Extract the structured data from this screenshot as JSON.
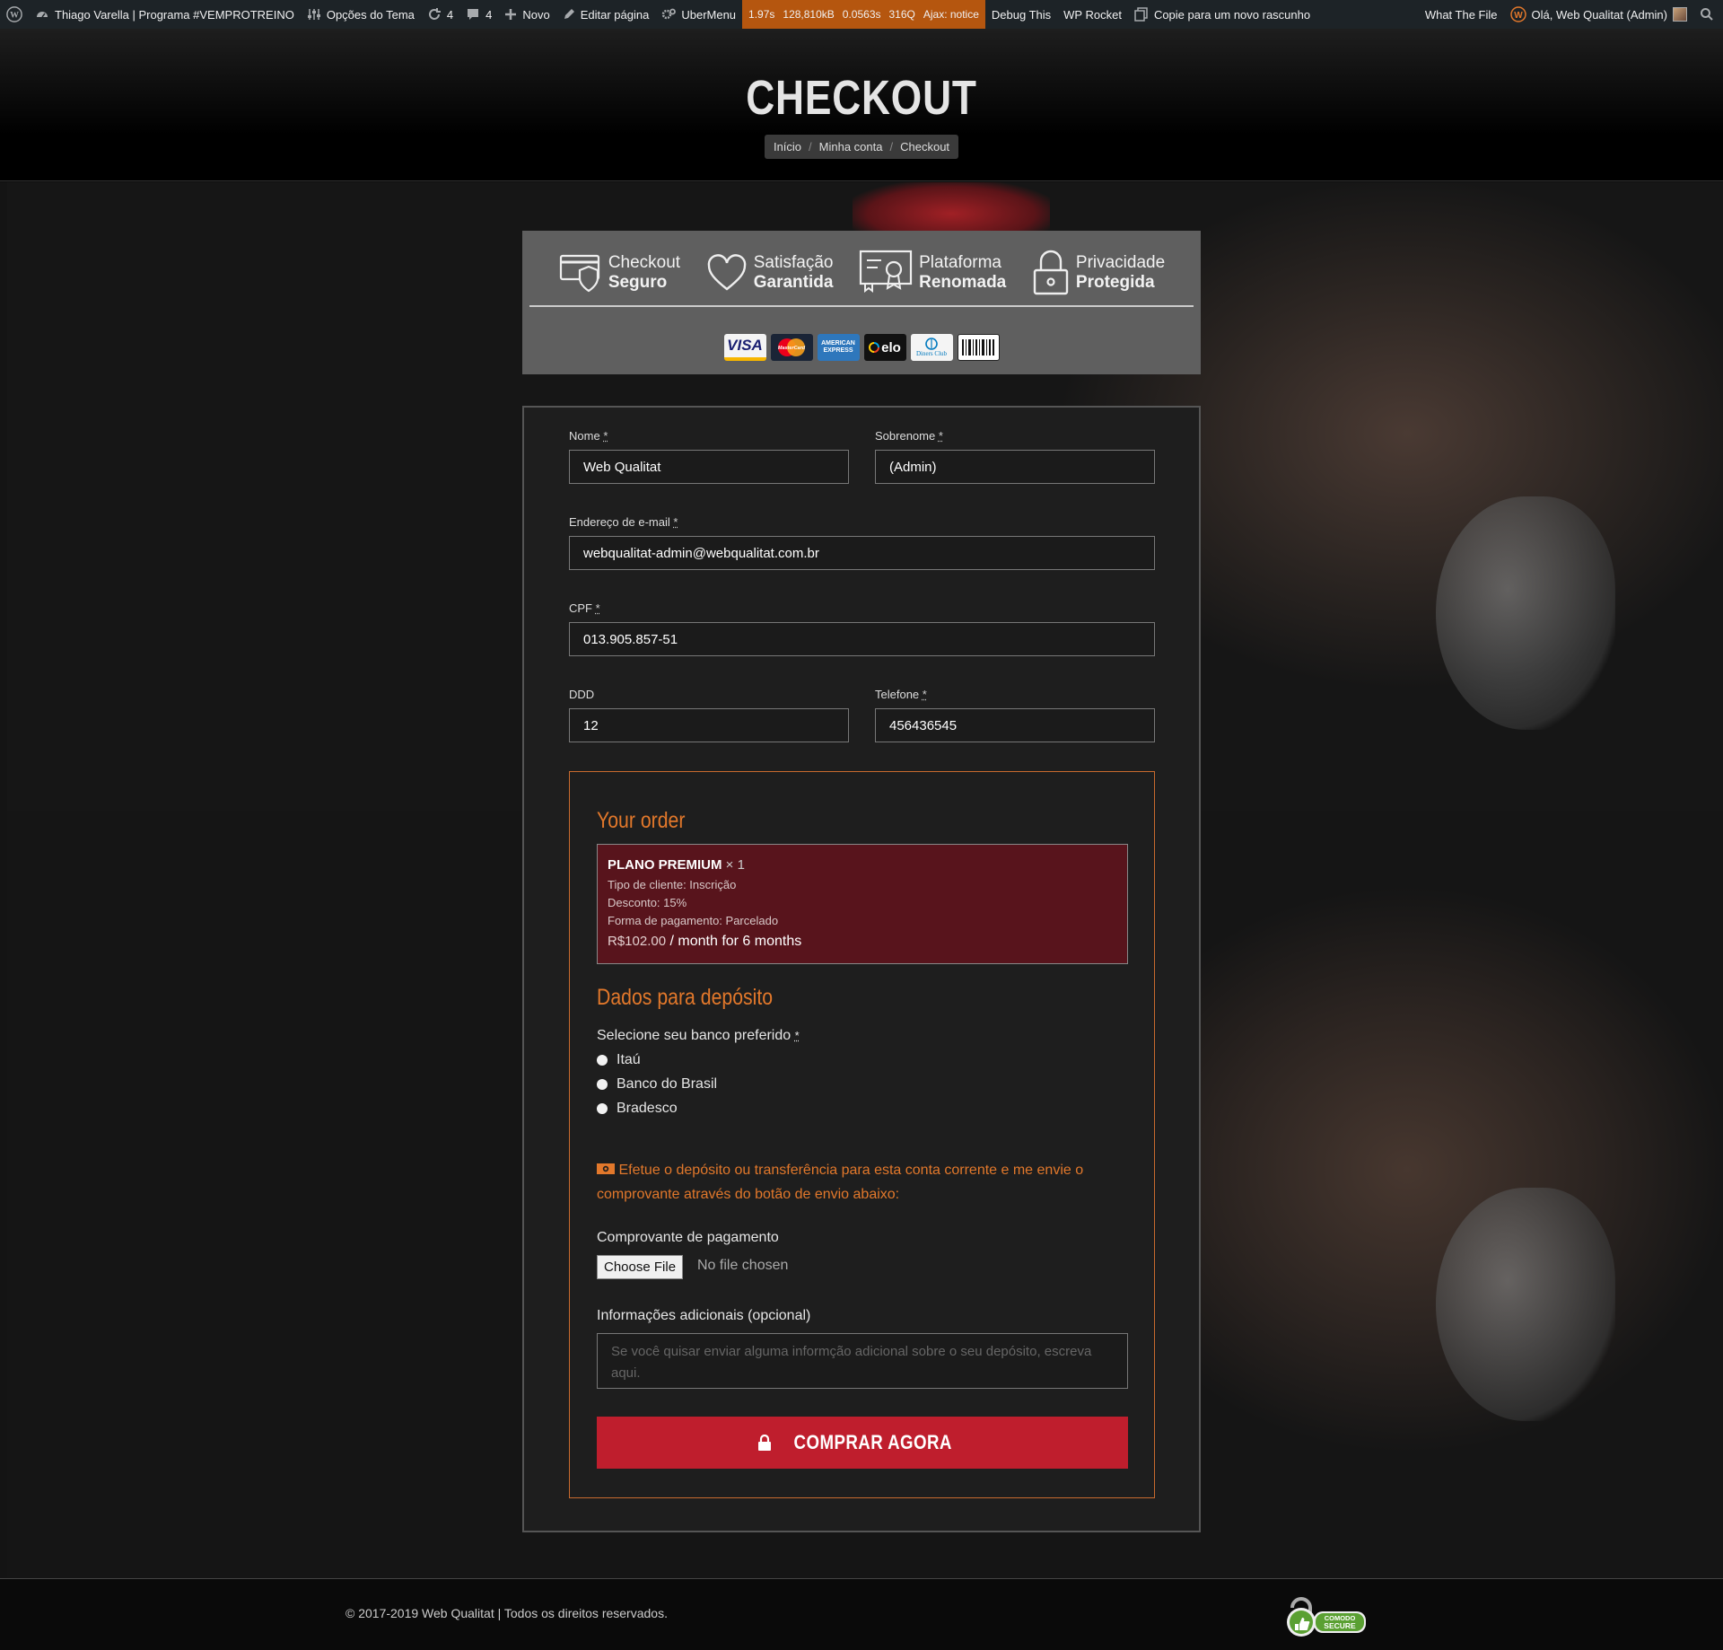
{
  "adminbar": {
    "site_name": "Thiago Varella | Programa #VEMPROTREINO",
    "theme_options": "Opções do Tema",
    "updates_count": "4",
    "comments_count": "4",
    "new": "Novo",
    "edit_page": "Editar página",
    "ubermenu": "UberMenu",
    "perf_time": "1.97s",
    "perf_mem": "128,810kB",
    "perf_query_time": "0.0563s",
    "perf_queries": "316Q",
    "perf_ajax": "Ajax: notice",
    "debug_this": "Debug This",
    "wp_rocket": "WP Rocket",
    "copy_draft": "Copie para um novo rascunho",
    "what_the_file": "What The File",
    "greeting": "Olá, Web Qualitat (Admin)"
  },
  "hero": {
    "title": "CHECKOUT",
    "breadcrumb": [
      "Início",
      "Minha conta",
      "Checkout"
    ],
    "sep": "/"
  },
  "trust": {
    "badges": [
      {
        "line1": "Checkout",
        "line2": "Seguro",
        "icon": "secure-card-icon"
      },
      {
        "line1": "Satisfação",
        "line2": "Garantida",
        "icon": "heart-icon"
      },
      {
        "line1": "Plataforma",
        "line2": "Renomada",
        "icon": "certificate-icon"
      },
      {
        "line1": "Privacidade",
        "line2": "Protegida",
        "icon": "lock-icon"
      }
    ],
    "cards": [
      "VISA",
      "MasterCard",
      "AMERICAN EXPRESS",
      "elo",
      "Diners Club",
      "boleto"
    ]
  },
  "form": {
    "first_name": {
      "label": "Nome",
      "value": "Web Qualitat"
    },
    "last_name": {
      "label": "Sobrenome",
      "value": "(Admin)"
    },
    "email": {
      "label": "Endereço de e-mail",
      "value": "webqualitat-admin@webqualitat.com.br"
    },
    "cpf": {
      "label": "CPF",
      "value": "013.905.857-51"
    },
    "ddd": {
      "label": "DDD",
      "value": "12"
    },
    "phone": {
      "label": "Telefone",
      "value": "456436545"
    },
    "req": "*"
  },
  "order": {
    "title": "Your order",
    "product": "PLANO PREMIUM",
    "qty": "× 1",
    "meta": [
      "Tipo de cliente:  Inscrição",
      "Desconto:  15%",
      "Forma de pagamento:  Parcelado"
    ],
    "price": "R$102.00",
    "period": " / month for 6 months"
  },
  "deposit": {
    "title": "Dados para depósito",
    "bank_label": "Selecione seu banco preferido",
    "banks": [
      "Itaú",
      "Banco do Brasil",
      "Bradesco"
    ],
    "notice": "Efetue o depósito ou transferência para esta conta corrente e me envie o comprovante através do botão de envio abaixo:",
    "receipt_label": "Comprovante de pagamento",
    "choose_file": "Choose File",
    "no_file": "No file chosen",
    "info_label": "Informações adicionais (opcional)",
    "info_placeholder": "Se você quisar enviar alguma informção adicional sobre o seu depósito, escreva aqui.",
    "buy": "COMPRAR AGORA"
  },
  "footer": {
    "copyright": "© 2017-2019 Web Qualitat | Todos os direitos reservados.",
    "seal_line1": "COMODO",
    "seal_line2": "SECURE"
  },
  "colors": {
    "accent": "#e2782b",
    "buy_button": "#bf1e2d",
    "order_item_bg": "#58141c"
  }
}
